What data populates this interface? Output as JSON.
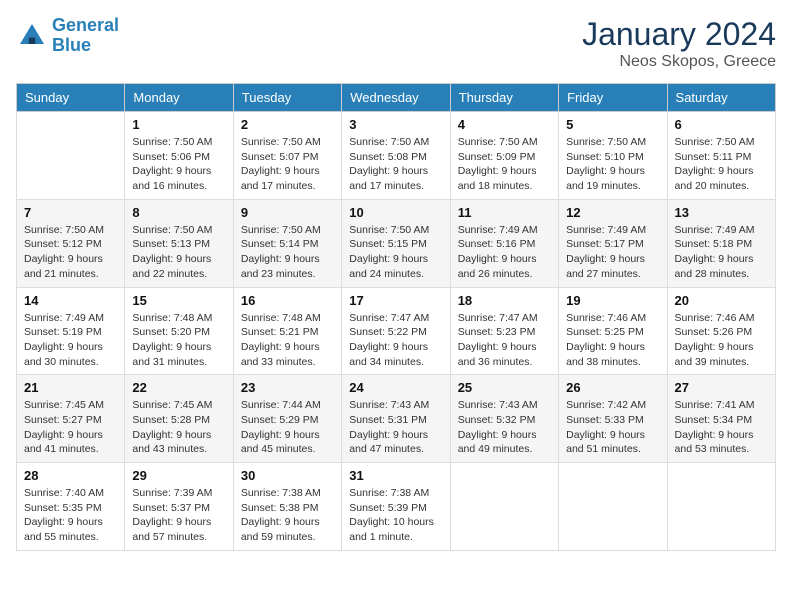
{
  "header": {
    "logo_line1": "General",
    "logo_line2": "Blue",
    "month_title": "January 2024",
    "location": "Neos Skopos, Greece"
  },
  "days_of_week": [
    "Sunday",
    "Monday",
    "Tuesday",
    "Wednesday",
    "Thursday",
    "Friday",
    "Saturday"
  ],
  "weeks": [
    [
      {
        "day": "",
        "sunrise": "",
        "sunset": "",
        "daylight": ""
      },
      {
        "day": "1",
        "sunrise": "Sunrise: 7:50 AM",
        "sunset": "Sunset: 5:06 PM",
        "daylight": "Daylight: 9 hours and 16 minutes."
      },
      {
        "day": "2",
        "sunrise": "Sunrise: 7:50 AM",
        "sunset": "Sunset: 5:07 PM",
        "daylight": "Daylight: 9 hours and 17 minutes."
      },
      {
        "day": "3",
        "sunrise": "Sunrise: 7:50 AM",
        "sunset": "Sunset: 5:08 PM",
        "daylight": "Daylight: 9 hours and 17 minutes."
      },
      {
        "day": "4",
        "sunrise": "Sunrise: 7:50 AM",
        "sunset": "Sunset: 5:09 PM",
        "daylight": "Daylight: 9 hours and 18 minutes."
      },
      {
        "day": "5",
        "sunrise": "Sunrise: 7:50 AM",
        "sunset": "Sunset: 5:10 PM",
        "daylight": "Daylight: 9 hours and 19 minutes."
      },
      {
        "day": "6",
        "sunrise": "Sunrise: 7:50 AM",
        "sunset": "Sunset: 5:11 PM",
        "daylight": "Daylight: 9 hours and 20 minutes."
      }
    ],
    [
      {
        "day": "7",
        "sunrise": "Sunrise: 7:50 AM",
        "sunset": "Sunset: 5:12 PM",
        "daylight": "Daylight: 9 hours and 21 minutes."
      },
      {
        "day": "8",
        "sunrise": "Sunrise: 7:50 AM",
        "sunset": "Sunset: 5:13 PM",
        "daylight": "Daylight: 9 hours and 22 minutes."
      },
      {
        "day": "9",
        "sunrise": "Sunrise: 7:50 AM",
        "sunset": "Sunset: 5:14 PM",
        "daylight": "Daylight: 9 hours and 23 minutes."
      },
      {
        "day": "10",
        "sunrise": "Sunrise: 7:50 AM",
        "sunset": "Sunset: 5:15 PM",
        "daylight": "Daylight: 9 hours and 24 minutes."
      },
      {
        "day": "11",
        "sunrise": "Sunrise: 7:49 AM",
        "sunset": "Sunset: 5:16 PM",
        "daylight": "Daylight: 9 hours and 26 minutes."
      },
      {
        "day": "12",
        "sunrise": "Sunrise: 7:49 AM",
        "sunset": "Sunset: 5:17 PM",
        "daylight": "Daylight: 9 hours and 27 minutes."
      },
      {
        "day": "13",
        "sunrise": "Sunrise: 7:49 AM",
        "sunset": "Sunset: 5:18 PM",
        "daylight": "Daylight: 9 hours and 28 minutes."
      }
    ],
    [
      {
        "day": "14",
        "sunrise": "Sunrise: 7:49 AM",
        "sunset": "Sunset: 5:19 PM",
        "daylight": "Daylight: 9 hours and 30 minutes."
      },
      {
        "day": "15",
        "sunrise": "Sunrise: 7:48 AM",
        "sunset": "Sunset: 5:20 PM",
        "daylight": "Daylight: 9 hours and 31 minutes."
      },
      {
        "day": "16",
        "sunrise": "Sunrise: 7:48 AM",
        "sunset": "Sunset: 5:21 PM",
        "daylight": "Daylight: 9 hours and 33 minutes."
      },
      {
        "day": "17",
        "sunrise": "Sunrise: 7:47 AM",
        "sunset": "Sunset: 5:22 PM",
        "daylight": "Daylight: 9 hours and 34 minutes."
      },
      {
        "day": "18",
        "sunrise": "Sunrise: 7:47 AM",
        "sunset": "Sunset: 5:23 PM",
        "daylight": "Daylight: 9 hours and 36 minutes."
      },
      {
        "day": "19",
        "sunrise": "Sunrise: 7:46 AM",
        "sunset": "Sunset: 5:25 PM",
        "daylight": "Daylight: 9 hours and 38 minutes."
      },
      {
        "day": "20",
        "sunrise": "Sunrise: 7:46 AM",
        "sunset": "Sunset: 5:26 PM",
        "daylight": "Daylight: 9 hours and 39 minutes."
      }
    ],
    [
      {
        "day": "21",
        "sunrise": "Sunrise: 7:45 AM",
        "sunset": "Sunset: 5:27 PM",
        "daylight": "Daylight: 9 hours and 41 minutes."
      },
      {
        "day": "22",
        "sunrise": "Sunrise: 7:45 AM",
        "sunset": "Sunset: 5:28 PM",
        "daylight": "Daylight: 9 hours and 43 minutes."
      },
      {
        "day": "23",
        "sunrise": "Sunrise: 7:44 AM",
        "sunset": "Sunset: 5:29 PM",
        "daylight": "Daylight: 9 hours and 45 minutes."
      },
      {
        "day": "24",
        "sunrise": "Sunrise: 7:43 AM",
        "sunset": "Sunset: 5:31 PM",
        "daylight": "Daylight: 9 hours and 47 minutes."
      },
      {
        "day": "25",
        "sunrise": "Sunrise: 7:43 AM",
        "sunset": "Sunset: 5:32 PM",
        "daylight": "Daylight: 9 hours and 49 minutes."
      },
      {
        "day": "26",
        "sunrise": "Sunrise: 7:42 AM",
        "sunset": "Sunset: 5:33 PM",
        "daylight": "Daylight: 9 hours and 51 minutes."
      },
      {
        "day": "27",
        "sunrise": "Sunrise: 7:41 AM",
        "sunset": "Sunset: 5:34 PM",
        "daylight": "Daylight: 9 hours and 53 minutes."
      }
    ],
    [
      {
        "day": "28",
        "sunrise": "Sunrise: 7:40 AM",
        "sunset": "Sunset: 5:35 PM",
        "daylight": "Daylight: 9 hours and 55 minutes."
      },
      {
        "day": "29",
        "sunrise": "Sunrise: 7:39 AM",
        "sunset": "Sunset: 5:37 PM",
        "daylight": "Daylight: 9 hours and 57 minutes."
      },
      {
        "day": "30",
        "sunrise": "Sunrise: 7:38 AM",
        "sunset": "Sunset: 5:38 PM",
        "daylight": "Daylight: 9 hours and 59 minutes."
      },
      {
        "day": "31",
        "sunrise": "Sunrise: 7:38 AM",
        "sunset": "Sunset: 5:39 PM",
        "daylight": "Daylight: 10 hours and 1 minute."
      },
      {
        "day": "",
        "sunrise": "",
        "sunset": "",
        "daylight": ""
      },
      {
        "day": "",
        "sunrise": "",
        "sunset": "",
        "daylight": ""
      },
      {
        "day": "",
        "sunrise": "",
        "sunset": "",
        "daylight": ""
      }
    ]
  ]
}
